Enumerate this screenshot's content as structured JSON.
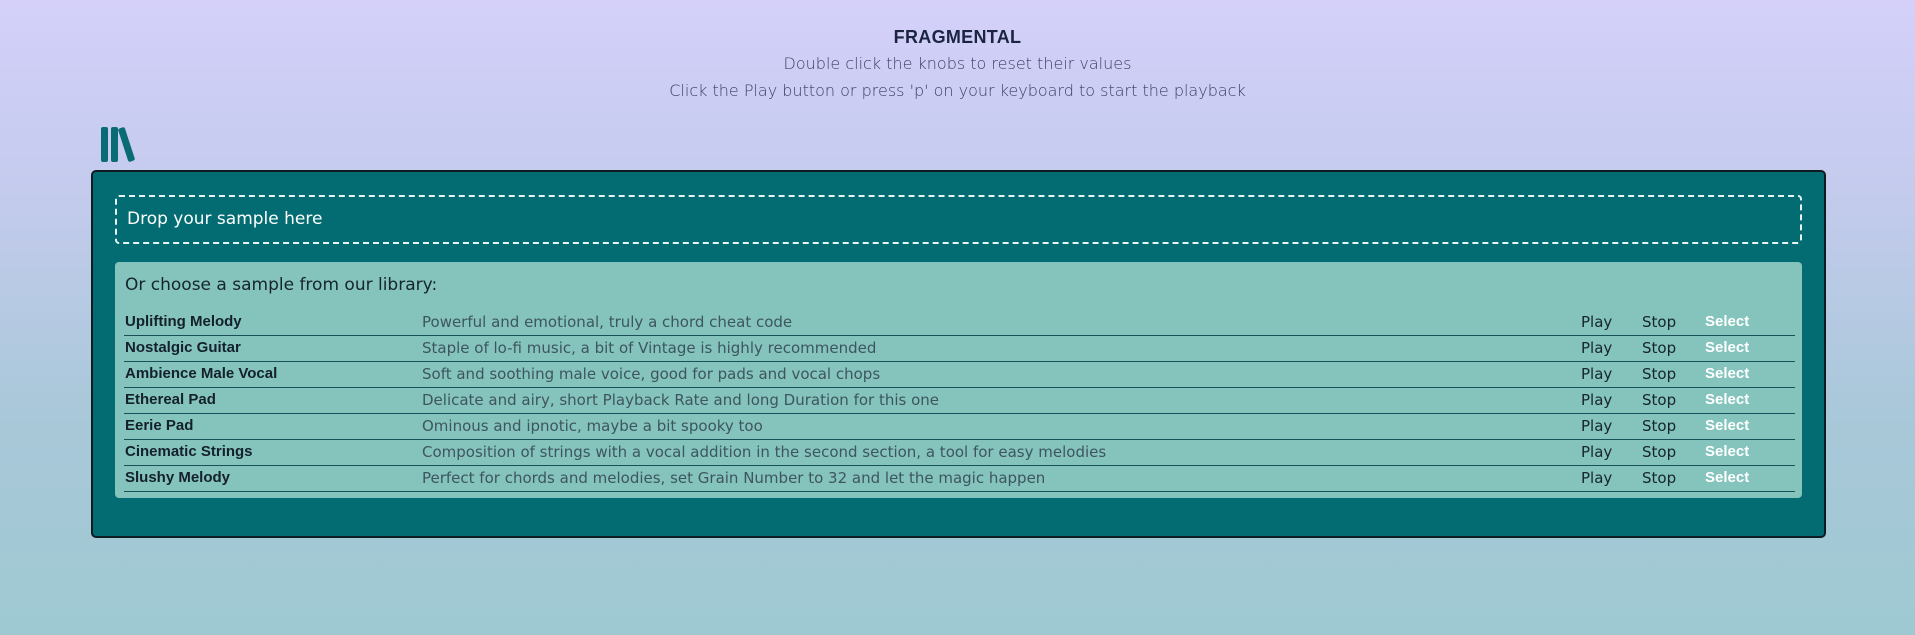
{
  "header": {
    "title": "FRAGMENTAL",
    "line1": "Double click the knobs to reset their values",
    "line2": "Click the Play button or press 'p' on your keyboard to start the playback"
  },
  "icons": {
    "library": "library-books-icon"
  },
  "colors": {
    "panel": "#036c73",
    "library_bg": "#84c4bd",
    "accent_text": "#ffffff"
  },
  "dropzone": {
    "label": "Drop your sample here"
  },
  "library": {
    "intro": "Or choose a sample from our library:",
    "samples": [
      {
        "name": "Uplifting Melody",
        "description": "Powerful and emotional, truly a chord cheat code",
        "play": "Play",
        "stop": "Stop",
        "select": "Select"
      },
      {
        "name": "Nostalgic Guitar",
        "description": "Staple of lo-fi music, a bit of Vintage is highly recommended",
        "play": "Play",
        "stop": "Stop",
        "select": "Select"
      },
      {
        "name": "Ambience Male Vocal",
        "description": "Soft and soothing male voice, good for pads and vocal chops",
        "play": "Play",
        "stop": "Stop",
        "select": "Select"
      },
      {
        "name": "Ethereal Pad",
        "description": "Delicate and airy, short Playback Rate and long Duration for this one",
        "play": "Play",
        "stop": "Stop",
        "select": "Select"
      },
      {
        "name": "Eerie Pad",
        "description": "Ominous and ipnotic, maybe a bit spooky too",
        "play": "Play",
        "stop": "Stop",
        "select": "Select"
      },
      {
        "name": "Cinematic Strings",
        "description": "Composition of strings with a vocal addition in the second section, a tool for easy melodies",
        "play": "Play",
        "stop": "Stop",
        "select": "Select"
      },
      {
        "name": "Slushy Melody",
        "description": "Perfect for chords and melodies, set Grain Number to 32 and let the magic happen",
        "play": "Play",
        "stop": "Stop",
        "select": "Select"
      }
    ]
  }
}
